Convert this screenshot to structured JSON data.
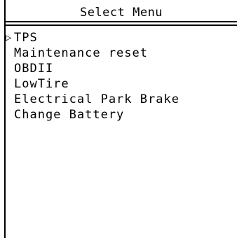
{
  "screen": {
    "title": "Select Menu",
    "cursor_glyph": "▷",
    "selected_index": 0
  },
  "menu": {
    "items": [
      {
        "label": "TPS"
      },
      {
        "label": "Maintenance reset"
      },
      {
        "label": "OBDII"
      },
      {
        "label": "LowTire"
      },
      {
        "label": "Electrical Park Brake"
      },
      {
        "label": "Change Battery"
      }
    ]
  }
}
